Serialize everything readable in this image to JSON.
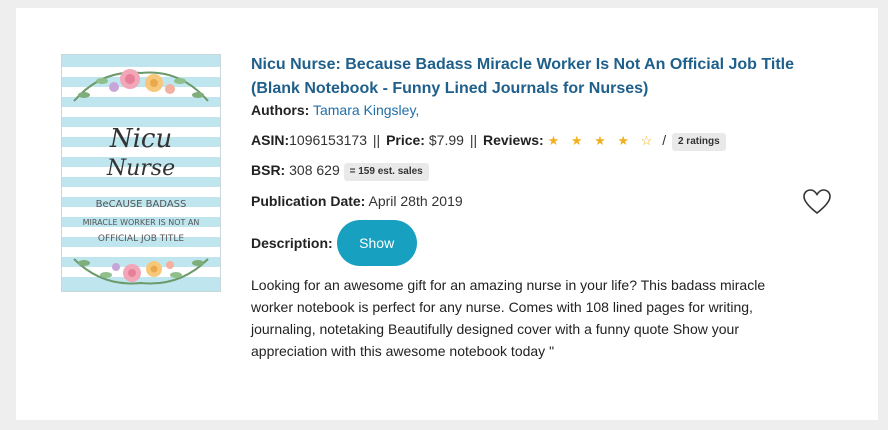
{
  "book": {
    "title": "Nicu Nurse: Because Badass Miracle Worker Is Not An Official Job Title (Blank Notebook - Funny Lined Journals for Nurses)",
    "authors_label": "Authors:",
    "authors_value": "Tamara Kingsley,",
    "asin_label": "ASIN:",
    "asin_value": "1096153173",
    "sep1": "||",
    "price_label": "Price:",
    "price_value": "$7.99",
    "sep2": "||",
    "reviews_label": "Reviews:",
    "stars": "★ ★ ★ ★ ☆",
    "rating_value": 4,
    "rating_max": 5,
    "reviews_sep": "/",
    "ratings_badge": "2 ratings",
    "bsr_label": "BSR:",
    "bsr_value": "308 629",
    "sales_badge": "= 159 est. sales",
    "pub_label": "Publication Date:",
    "pub_value": "April 28th 2019",
    "desc_label": "Description:",
    "show_label": "Show",
    "description": "Looking for an awesome gift for an amazing nurse in your life? This badass miracle worker notebook is perfect for any nurse. Comes with 108 lined pages for writing, journaling, notetaking Beautifully designed cover with a funny quote Show your appreciation with this awesome notebook today \""
  },
  "cover": {
    "line1": "Nicu",
    "line2": "Nurse",
    "sub1": "BeCAUSE BADASS",
    "sub2": "MIRACLE WORKER IS NOT AN",
    "sub3": "OFFICIAL JOB TITLE"
  },
  "icons": {
    "favorite": "heart-outline-icon",
    "star": "star-icon"
  },
  "colors": {
    "title": "#1f5f8b",
    "link": "#1f6fa8",
    "button": "#17a0bf",
    "star": "#f2b01e",
    "cover_stripe": "#bfe6ef"
  }
}
